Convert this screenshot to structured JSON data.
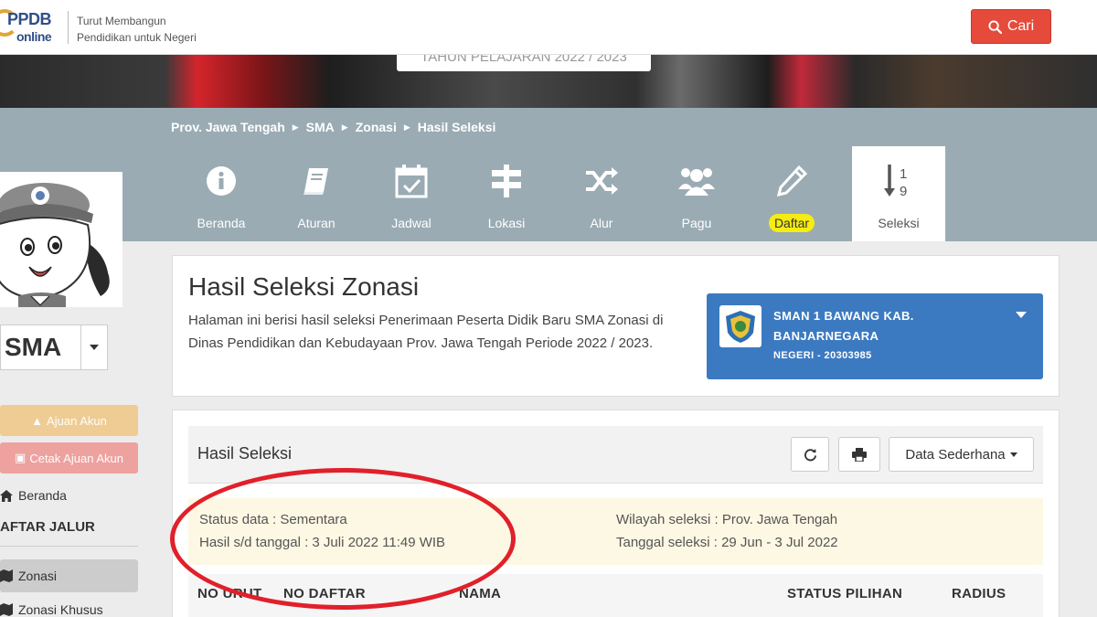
{
  "header": {
    "logo_top": "PPDB",
    "logo_bottom": "online",
    "tagline_line1": "Turut Membangun",
    "tagline_line2": "Pendidikan untuk Negeri",
    "search_label": "Cari"
  },
  "banner": {
    "text": "TAHUN PELAJARAN 2022 / 2023"
  },
  "breadcrumb": {
    "items": [
      "Prov. Jawa Tengah",
      "SMA",
      "Zonasi",
      "Hasil Seleksi"
    ]
  },
  "nav": {
    "tabs": [
      {
        "label": "Beranda",
        "icon": "info-icon"
      },
      {
        "label": "Aturan",
        "icon": "book-icon"
      },
      {
        "label": "Jadwal",
        "icon": "calendar-icon"
      },
      {
        "label": "Lokasi",
        "icon": "signpost-icon"
      },
      {
        "label": "Alur",
        "icon": "shuffle-icon"
      },
      {
        "label": "Pagu",
        "icon": "users-icon"
      },
      {
        "label": "Daftar",
        "icon": "pencil-icon"
      },
      {
        "label": "Seleksi",
        "icon": "sort-numeric-icon"
      }
    ]
  },
  "sidebar": {
    "level": "SMA",
    "btn_ajuan": "Ajuan Akun",
    "btn_cetak": "Cetak Ajuan Akun",
    "beranda": "Beranda",
    "section": "AFTAR JALUR",
    "zonasi": "Zonasi",
    "zonasi_khusus": "Zonasi Khusus"
  },
  "main": {
    "title": "Hasil Seleksi Zonasi",
    "description": "Halaman ini berisi hasil seleksi Penerimaan Peserta Didik Baru SMA Zonasi di Dinas Pendidikan dan Kebudayaan Prov. Jawa Tengah Periode 2022 / 2023.",
    "school": {
      "name": "SMAN 1 BAWANG KAB. BANJARNEGARA",
      "meta": "NEGERI - 20303985"
    }
  },
  "results": {
    "title": "Hasil Seleksi",
    "view_select": "Data Sederhana",
    "status": "Status data : Sementara",
    "as_of": "Hasil s/d tanggal : 3 Juli 2022 11:49 WIB",
    "region": "Wilayah seleksi : Prov. Jawa Tengah",
    "period": "Tanggal seleksi : 29 Jun - 3 Jul 2022",
    "columns": [
      "NO URUT",
      "NO DAFTAR",
      "NAMA",
      "STATUS PILIHAN",
      "RADIUS"
    ]
  },
  "colors": {
    "search_button": "#e64a3b",
    "nav_band": "#9aabb3",
    "school_card": "#3b79c0",
    "daftar_highlight": "#f5ec12",
    "annotation": "#e0202a",
    "info_box": "#fcf8e3"
  }
}
